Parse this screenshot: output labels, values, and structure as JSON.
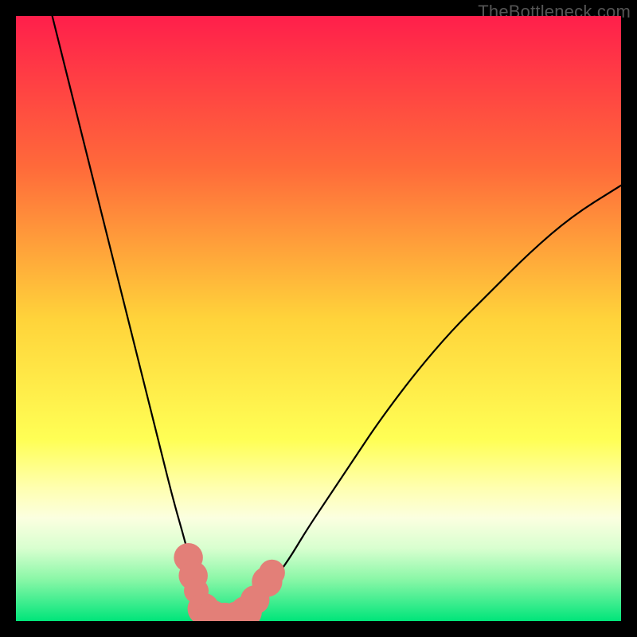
{
  "watermark": "TheBottleneck.com",
  "chart_data": {
    "type": "line",
    "title": "",
    "xlabel": "",
    "ylabel": "",
    "xlim": [
      0,
      100
    ],
    "ylim": [
      0,
      100
    ],
    "grid": false,
    "gradient_stops": [
      {
        "offset": 0.0,
        "color": "#ff1f4b"
      },
      {
        "offset": 0.25,
        "color": "#ff6a3a"
      },
      {
        "offset": 0.5,
        "color": "#ffd33a"
      },
      {
        "offset": 0.7,
        "color": "#ffff55"
      },
      {
        "offset": 0.78,
        "color": "#ffffb0"
      },
      {
        "offset": 0.83,
        "color": "#fbffe0"
      },
      {
        "offset": 0.88,
        "color": "#d8ffcf"
      },
      {
        "offset": 0.93,
        "color": "#8cf7a8"
      },
      {
        "offset": 1.0,
        "color": "#00e57a"
      }
    ],
    "series": [
      {
        "name": "curve-left",
        "type": "line",
        "x": [
          6,
          8,
          10,
          12,
          14,
          16,
          18,
          20,
          22,
          24,
          26,
          28,
          29.5,
          31,
          33,
          35
        ],
        "y": [
          100,
          92,
          84,
          76,
          68,
          60,
          52,
          44,
          36,
          28,
          20,
          13,
          7,
          3,
          1,
          0
        ]
      },
      {
        "name": "curve-right",
        "type": "line",
        "x": [
          35,
          37,
          39,
          42,
          45,
          48,
          52,
          56,
          60,
          66,
          72,
          78,
          85,
          92,
          100
        ],
        "y": [
          0,
          1,
          3,
          6,
          10,
          15,
          21,
          27,
          33,
          41,
          48,
          54,
          61,
          67,
          72
        ]
      }
    ],
    "markers": {
      "name": "highlight-dots",
      "color": "#e37f78",
      "points": [
        {
          "x": 28.5,
          "y": 10.5,
          "r": 2.0
        },
        {
          "x": 29.3,
          "y": 7.5,
          "r": 2.0
        },
        {
          "x": 29.8,
          "y": 5.0,
          "r": 1.7
        },
        {
          "x": 31.0,
          "y": 2.0,
          "r": 2.2
        },
        {
          "x": 32.5,
          "y": 0.8,
          "r": 2.2
        },
        {
          "x": 34.5,
          "y": 0.4,
          "r": 2.2
        },
        {
          "x": 36.5,
          "y": 0.6,
          "r": 2.2
        },
        {
          "x": 38.0,
          "y": 1.5,
          "r": 2.2
        },
        {
          "x": 39.5,
          "y": 3.5,
          "r": 2.0
        },
        {
          "x": 41.5,
          "y": 6.5,
          "r": 2.1
        },
        {
          "x": 42.3,
          "y": 8.0,
          "r": 1.8
        }
      ]
    }
  }
}
